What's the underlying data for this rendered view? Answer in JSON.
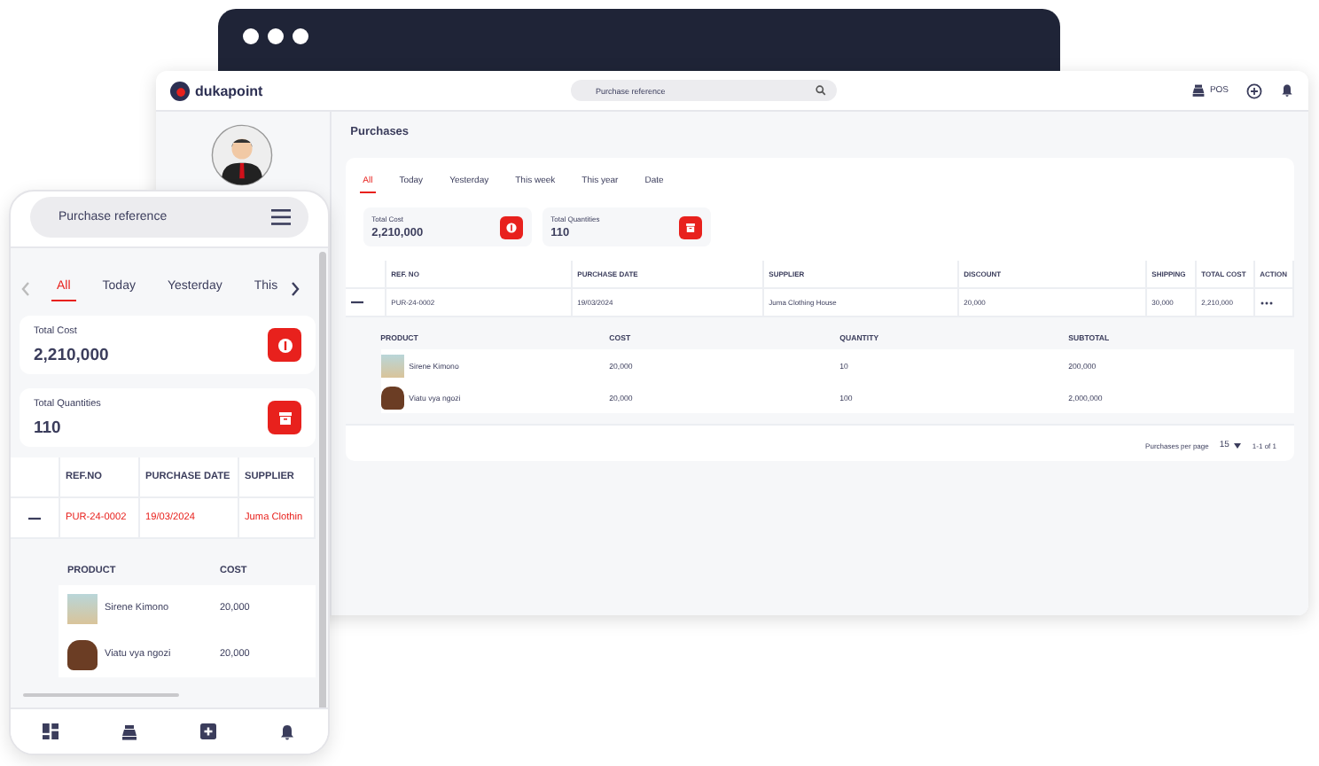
{
  "desktop": {
    "brand": "dukapoint",
    "search": {
      "placeholder": "Purchase reference"
    },
    "pos_label": "POS",
    "page_title": "Purchases",
    "tabs": [
      {
        "label": "All",
        "selected": true
      },
      {
        "label": "Today",
        "selected": false
      },
      {
        "label": "Yesterday",
        "selected": false
      },
      {
        "label": "This week",
        "selected": false
      },
      {
        "label": "This year",
        "selected": false
      },
      {
        "label": "Date",
        "selected": false
      }
    ],
    "stats": [
      {
        "kind": "cost",
        "label": "Total Cost",
        "value": "2,210,000"
      },
      {
        "kind": "quantity",
        "label": "Total Quantities",
        "value": "110"
      }
    ],
    "table": {
      "columns": [
        "REF. NO",
        "PURCHASE DATE",
        "SUPPLIER",
        "DISCOUNT",
        "SHIPPING",
        "TOTAL COST",
        "ACTION"
      ],
      "rows": [
        {
          "expanded": true,
          "selected": false,
          "cells": [
            "PUR-24-0002",
            "19/03/2024",
            "Juma Clothing House",
            "20,000",
            "30,000",
            "2,210,000"
          ]
        }
      ]
    },
    "detail": {
      "columns": [
        "PRODUCT",
        "COST",
        "QUANTITY",
        "SUBTOTAL"
      ],
      "rows": [
        {
          "kind": "clothing",
          "cells": [
            "Sirene Kimono",
            "20,000",
            "10",
            "200,000"
          ]
        },
        {
          "kind": "shoes",
          "cells": [
            "Viatu vya ngozi",
            "20,000",
            "100",
            "2,000,000"
          ]
        }
      ]
    },
    "pagination": {
      "per_page_label": "Purchases per page",
      "per_page": "15",
      "range": "1-1 of 1"
    }
  },
  "phone": {
    "search": {
      "placeholder": "Purchase reference"
    },
    "tabs": [
      {
        "label": "All",
        "selected": true
      },
      {
        "label": "Today",
        "selected": false
      },
      {
        "label": "Yesterday",
        "selected": false
      },
      {
        "label": "This",
        "selected": false
      }
    ],
    "stats": [
      {
        "kind": "cost",
        "label": "Total Cost",
        "value": "2,210,000"
      },
      {
        "kind": "quantity",
        "label": "Total Quantities",
        "value": "110"
      }
    ],
    "table": {
      "columns": [
        "REF.NO",
        "PURCHASE DATE",
        "SUPPLIER"
      ],
      "rows": [
        {
          "expanded": true,
          "selected": true,
          "cells": [
            "PUR-24-0002",
            "19/03/2024",
            "Juma Clothin"
          ]
        }
      ]
    },
    "detail": {
      "columns": [
        "PRODUCT",
        "COST"
      ],
      "rows": [
        {
          "kind": "clothing",
          "cells": [
            "Sirene Kimono",
            "20,000"
          ]
        },
        {
          "kind": "shoes",
          "cells": [
            "Viatu vya ngozi",
            "20,000"
          ]
        }
      ]
    }
  }
}
